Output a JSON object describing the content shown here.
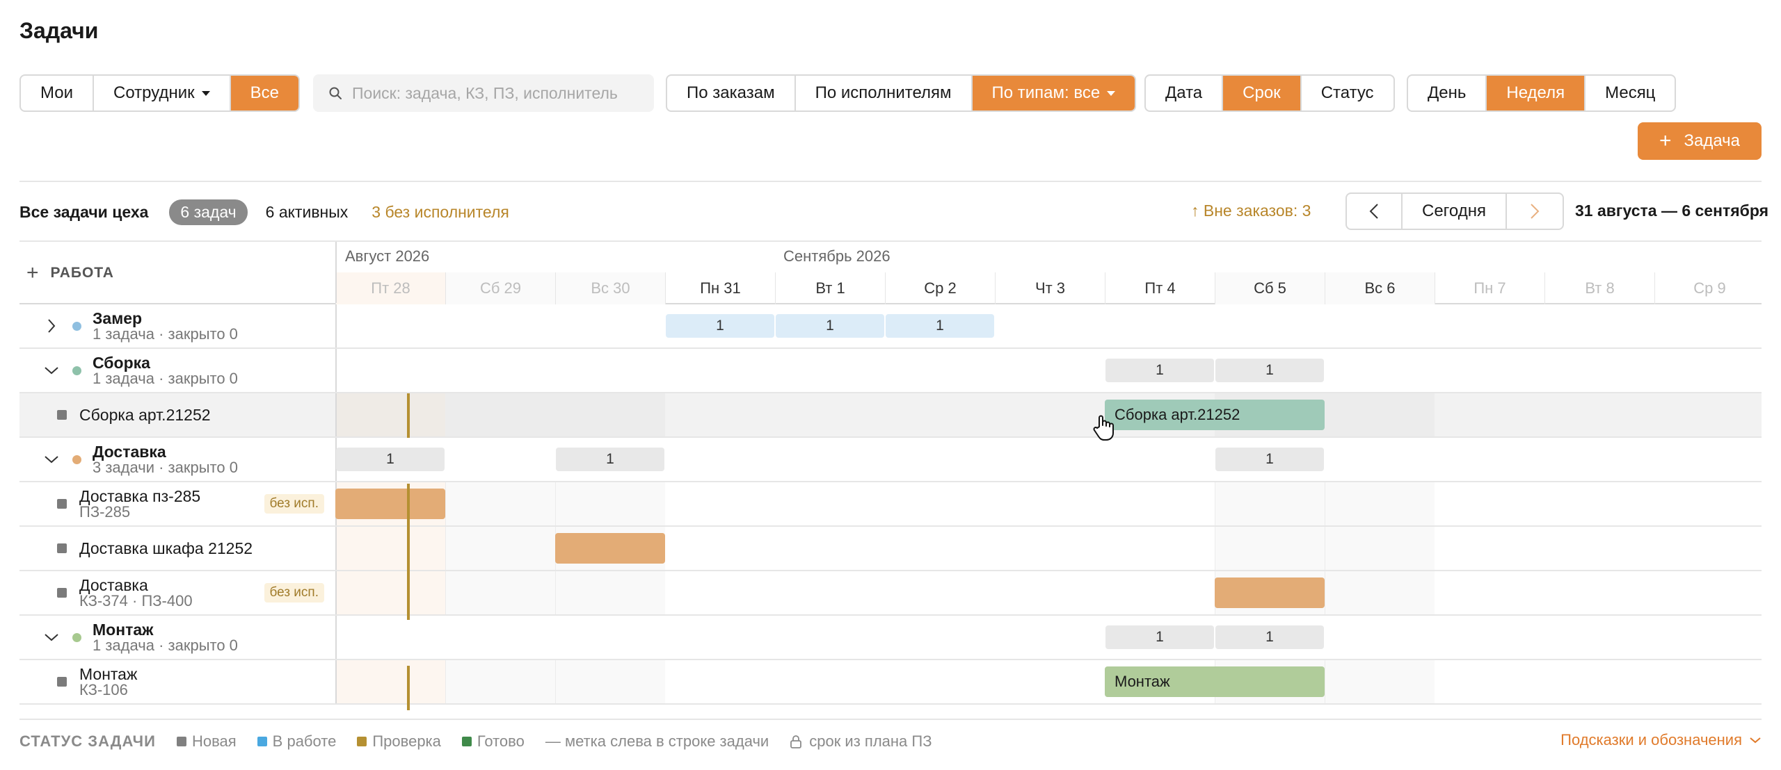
{
  "page": {
    "title": "Задачи"
  },
  "filters": {
    "scope": [
      "Мои",
      "Сотрудник",
      "Все"
    ],
    "search_placeholder": "Поиск: задача, КЗ, ПЗ, исполнитель",
    "group": [
      "По заказам",
      "По исполнителям",
      "По типам: все"
    ],
    "date_field": [
      "Дата",
      "Срок",
      "Статус"
    ],
    "period": [
      "День",
      "Неделя",
      "Месяц"
    ],
    "add_task": "Задача"
  },
  "summary": {
    "title": "Все задачи цеха",
    "count_badge": "6 задач",
    "active": "6 активных",
    "no_executor": "3 без исполнителя",
    "outside_orders": "↑ Вне заказов: 3",
    "today_button": "Сегодня",
    "date_range": "31 августа — 6 сентября"
  },
  "grid": {
    "work_header": "РАБОТА",
    "months": [
      "Август 2026",
      "Сентябрь 2026"
    ],
    "days": [
      "Пт 28",
      "Сб 29",
      "Вс 30",
      "Пн 31",
      "Вт 1",
      "Ср 2",
      "Чт 3",
      "Пт 4",
      "Сб 5",
      "Вс 6",
      "Пн 7",
      "Вт 8",
      "Ср 9"
    ],
    "groups": [
      {
        "name": "Замер",
        "sub": "1 задача · закрыто 0",
        "color": "#8fbfe0",
        "expanded": false
      },
      {
        "name": "Сборка",
        "sub": "1 задача · закрыто 0",
        "color": "#8ec1aa",
        "expanded": true
      },
      {
        "name": "Доставка",
        "sub": "3 задачи · закрыто 0",
        "color": "#e3ac76",
        "expanded": true
      },
      {
        "name": "Монтаж",
        "sub": "1 задача · закрыто 0",
        "color": "#a7c98f",
        "expanded": true
      }
    ],
    "counts": {
      "zamer": [
        "1",
        "1",
        "1"
      ],
      "sborka": [
        "1",
        "1"
      ],
      "dostavka": [
        "1",
        "1",
        "1"
      ],
      "montazh": [
        "1",
        "1"
      ]
    },
    "tasks": [
      {
        "name": "Сборка арт.21252",
        "sub": "",
        "badge": "",
        "bar_label": "Сборка арт.21252"
      },
      {
        "name": "Доставка пз-285",
        "sub": "ПЗ-285",
        "badge": "без исп.",
        "bar_label": ""
      },
      {
        "name": "Доставка шкафа 21252",
        "sub": "",
        "badge": "",
        "bar_label": ""
      },
      {
        "name": "Доставка",
        "sub": "КЗ-374 · ПЗ-400",
        "badge": "без исп.",
        "bar_label": ""
      },
      {
        "name": "Монтаж",
        "sub": "КЗ-106",
        "badge": "",
        "bar_label": "Монтаж"
      }
    ]
  },
  "legend": {
    "title": "СТАТУС ЗАДАЧИ",
    "items": [
      {
        "label": "Новая",
        "color": "#808080"
      },
      {
        "label": "В работе",
        "color": "#4aa8e0"
      },
      {
        "label": "Проверка",
        "color": "#b59032"
      },
      {
        "label": "Готово",
        "color": "#3f8a4a"
      }
    ],
    "note": "— метка слева в строке задачи",
    "lock_note": "срок из плана ПЗ",
    "hints": "Подсказки и обозначения"
  },
  "colors": {
    "accent": "#e8893a",
    "today_line": "#b59032"
  }
}
